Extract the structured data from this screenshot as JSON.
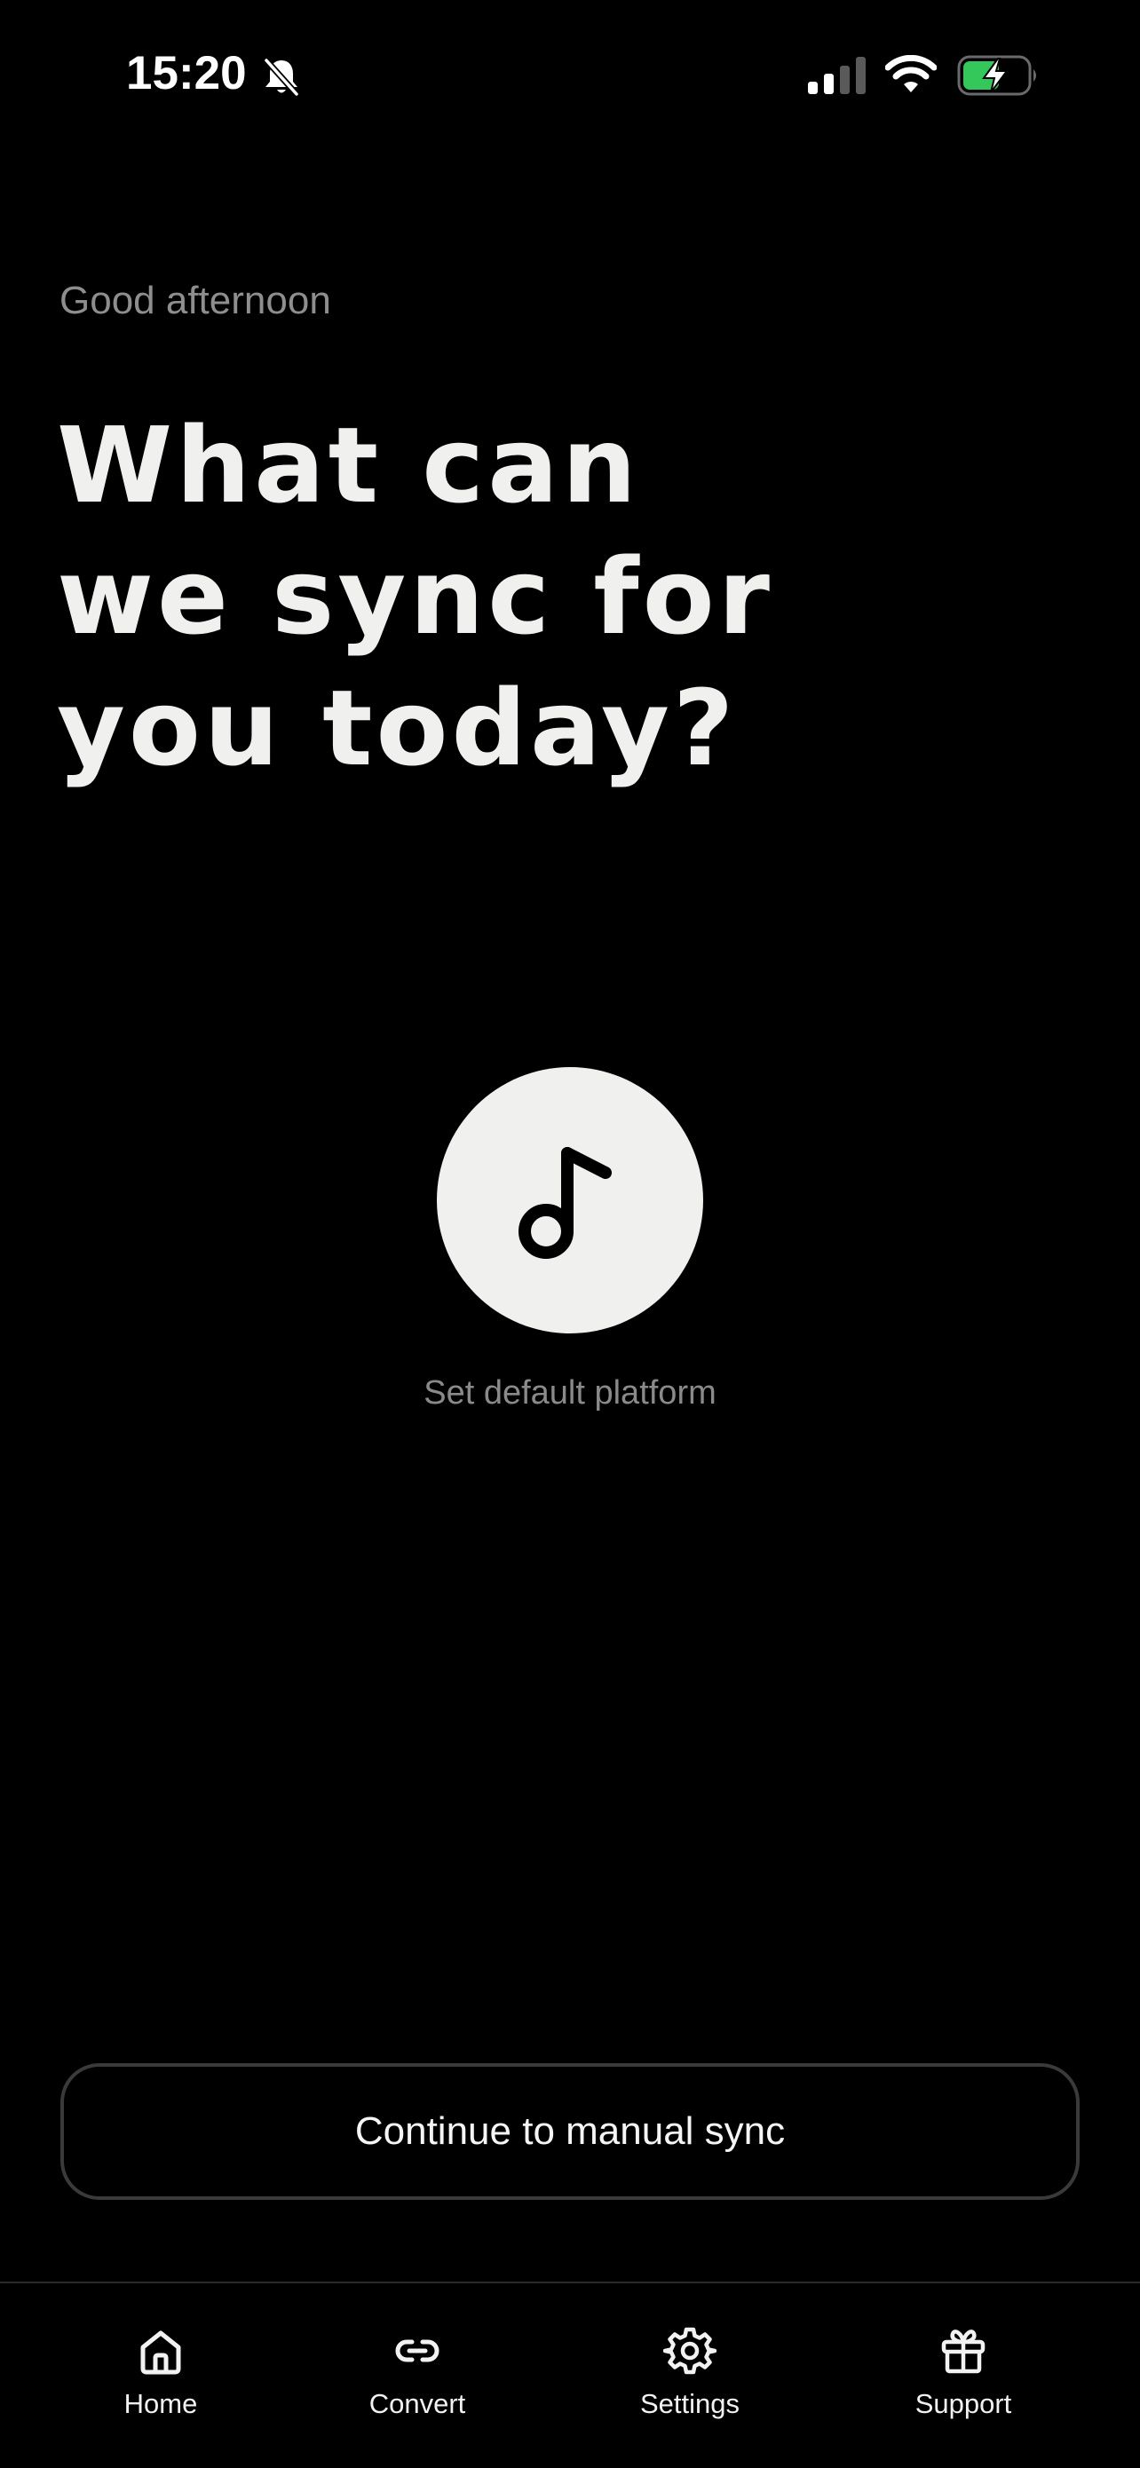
{
  "status_bar": {
    "time": "15:20",
    "icons": [
      "bell-slash-icon",
      "cellular-signal-icon",
      "wifi-icon",
      "battery-charging-icon"
    ],
    "battery_color": "#34c759"
  },
  "greeting": "Good afternoon",
  "headline": {
    "line1": "What can",
    "line2": "we sync for",
    "line3": "you today?"
  },
  "platform": {
    "icon": "music-note-icon",
    "label": "Set default platform"
  },
  "manual_sync_label": "Continue to manual sync",
  "tabs": [
    {
      "label": "Home",
      "icon": "house-icon"
    },
    {
      "label": "Convert",
      "icon": "link-icon"
    },
    {
      "label": "Settings",
      "icon": "gear-icon"
    },
    {
      "label": "Support",
      "icon": "gift-icon"
    }
  ],
  "colors": {
    "background": "#000000",
    "foreground": "#f0f0ee",
    "muted": "#8e8e8e"
  }
}
